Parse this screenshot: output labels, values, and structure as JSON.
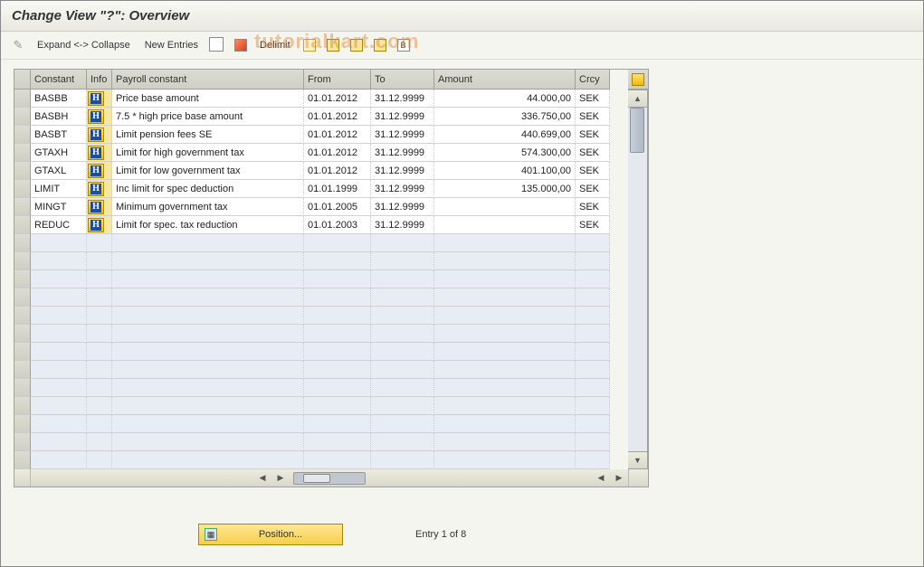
{
  "title": "Change View \"?\": Overview",
  "watermark": "tutorialkart.com",
  "toolbar": {
    "expand_collapse": "Expand <-> Collapse",
    "new_entries": "New Entries",
    "delimit": "Delimit"
  },
  "columns": {
    "constant": "Constant",
    "info": "Info",
    "payroll": "Payroll constant",
    "from": "From",
    "to": "To",
    "amount": "Amount",
    "crcy": "Crcy"
  },
  "rows": [
    {
      "constant": "BASBB",
      "payroll": "Price base amount",
      "from": "01.01.2012",
      "to": "31.12.9999",
      "amount": "44.000,00",
      "crcy": "SEK"
    },
    {
      "constant": "BASBH",
      "payroll": "7.5 * high price base amount",
      "from": "01.01.2012",
      "to": "31.12.9999",
      "amount": "336.750,00",
      "crcy": "SEK"
    },
    {
      "constant": "BASBT",
      "payroll": "Limit pension fees SE",
      "from": "01.01.2012",
      "to": "31.12.9999",
      "amount": "440.699,00",
      "crcy": "SEK"
    },
    {
      "constant": "GTAXH",
      "payroll": "Limit for high government tax",
      "from": "01.01.2012",
      "to": "31.12.9999",
      "amount": "574.300,00",
      "crcy": "SEK"
    },
    {
      "constant": "GTAXL",
      "payroll": "Limit for low government tax",
      "from": "01.01.2012",
      "to": "31.12.9999",
      "amount": "401.100,00",
      "crcy": "SEK"
    },
    {
      "constant": "LIMIT",
      "payroll": "Inc limit for spec deduction",
      "from": "01.01.1999",
      "to": "31.12.9999",
      "amount": "135.000,00",
      "crcy": "SEK"
    },
    {
      "constant": "MINGT",
      "payroll": "Minimum government tax",
      "from": "01.01.2005",
      "to": "31.12.9999",
      "amount": "",
      "crcy": "SEK"
    },
    {
      "constant": "REDUC",
      "payroll": "Limit for spec. tax reduction",
      "from": "01.01.2003",
      "to": "31.12.9999",
      "amount": "",
      "crcy": "SEK"
    }
  ],
  "empty_rows": 13,
  "footer": {
    "position_label": "Position...",
    "entry_text": "Entry 1 of 8"
  }
}
